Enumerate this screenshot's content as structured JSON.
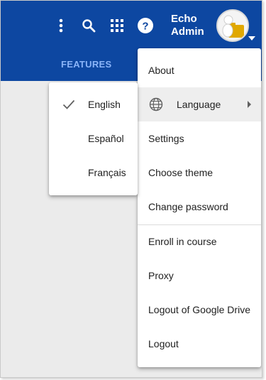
{
  "header": {
    "user_name_line1": "Echo",
    "user_name_line2": "Admin",
    "brand_color": "#0d47a1",
    "icons": [
      "more-vert-icon",
      "search-icon",
      "apps-grid-icon",
      "help-icon"
    ]
  },
  "tabs": {
    "features_label": "FEATURES"
  },
  "user_menu": {
    "items": [
      {
        "label": "About"
      },
      {
        "label": "Language",
        "icon": "globe-icon",
        "has_submenu": true
      },
      {
        "label": "Settings"
      },
      {
        "label": "Choose theme"
      },
      {
        "label": "Change password"
      },
      {
        "label": "Enroll in course"
      },
      {
        "label": "Proxy"
      },
      {
        "label": "Logout of Google Drive"
      },
      {
        "label": "Logout"
      }
    ]
  },
  "language_submenu": {
    "items": [
      {
        "label": "English",
        "selected": true
      },
      {
        "label": "Español",
        "selected": false
      },
      {
        "label": "Français",
        "selected": false
      }
    ]
  }
}
